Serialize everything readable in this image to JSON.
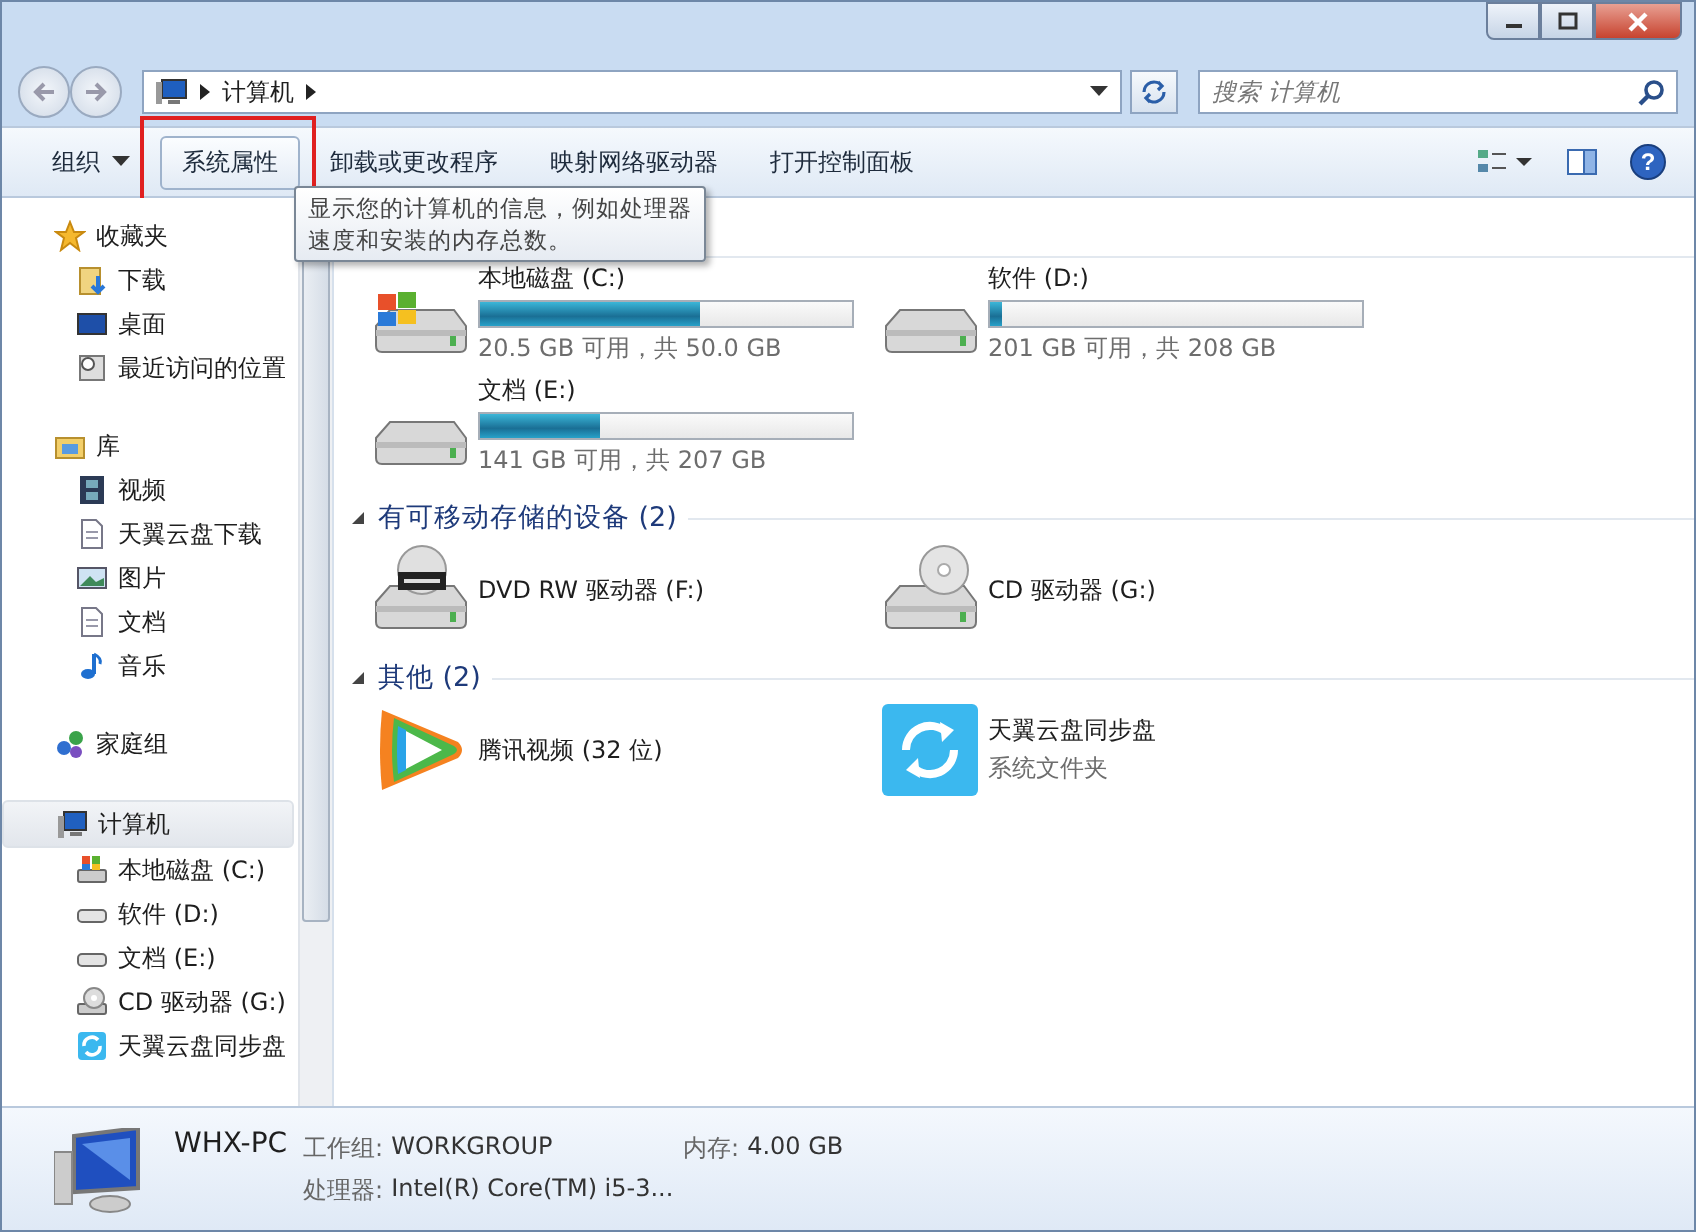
{
  "address_bar": {
    "path": [
      "计算机"
    ]
  },
  "search": {
    "placeholder": "搜索 计算机"
  },
  "toolbar": {
    "items": [
      {
        "label": "组织",
        "dropdown": true,
        "annotated": false
      },
      {
        "label": "系统属性",
        "dropdown": false,
        "annotated": true
      },
      {
        "label": "卸载或更改程序",
        "dropdown": false,
        "annotated": false
      },
      {
        "label": "映射网络驱动器",
        "dropdown": false,
        "annotated": false
      },
      {
        "label": "打开控制面板",
        "dropdown": false,
        "annotated": false
      }
    ],
    "help_label": "?"
  },
  "tooltip": {
    "lines": [
      "显示您的计算机的信息，例如处理器",
      "速度和安装的内存总数。"
    ]
  },
  "sidebar": {
    "groups": [
      {
        "label": "收藏夹",
        "kind": "favorites",
        "selected": false,
        "children": [
          {
            "label": "下载",
            "kind": "downloads",
            "selected": false
          },
          {
            "label": "桌面",
            "kind": "desktop",
            "selected": false
          },
          {
            "label": "最近访问的位置",
            "kind": "recent",
            "selected": false
          }
        ]
      },
      {
        "label": "库",
        "kind": "libraries",
        "selected": false,
        "children": [
          {
            "label": "视频",
            "kind": "videos",
            "selected": false
          },
          {
            "label": "天翼云盘下载",
            "kind": "document",
            "selected": false
          },
          {
            "label": "图片",
            "kind": "pictures",
            "selected": false
          },
          {
            "label": "文档",
            "kind": "document",
            "selected": false
          },
          {
            "label": "音乐",
            "kind": "music",
            "selected": false
          }
        ]
      },
      {
        "label": "家庭组",
        "kind": "homegroup",
        "selected": false
      },
      {
        "label": "计算机",
        "kind": "computer",
        "selected": true,
        "children": [
          {
            "label": "本地磁盘 (C:)",
            "kind": "system_drive",
            "selected": false
          },
          {
            "label": "软件 (D:)",
            "kind": "drive",
            "selected": false
          },
          {
            "label": "文档 (E:)",
            "kind": "drive",
            "selected": false
          },
          {
            "label": "CD 驱动器 (G:)",
            "kind": "cd_drive",
            "selected": false
          },
          {
            "label": "天翼云盘同步盘",
            "kind": "sync_folder",
            "selected": false
          }
        ]
      }
    ]
  },
  "sections": [
    {
      "items": [
        {
          "kind": "system_drive",
          "name": "本地磁盘 (C:)",
          "level": 0.59,
          "detail": "20.5 GB 可用，共 50.0 GB"
        },
        {
          "kind": "drive",
          "name": "软件 (D:)",
          "level": 0.03,
          "detail": "201 GB 可用，共 208 GB"
        },
        {
          "kind": "drive",
          "name": "文档 (E:)",
          "level": 0.32,
          "detail": "141 GB 可用，共 207 GB"
        }
      ]
    },
    {
      "title": "有可移动存储的设备 (2)",
      "items": [
        {
          "kind": "dvd_drive",
          "name": "DVD RW 驱动器 (F:)"
        },
        {
          "kind": "cd_drive",
          "name": "CD 驱动器 (G:)"
        }
      ]
    },
    {
      "title": "其他 (2)",
      "items": [
        {
          "kind": "app",
          "name": "腾讯视频 (32 位)"
        },
        {
          "kind": "sync_folder",
          "name": "天翼云盘同步盘",
          "detail": "系统文件夹"
        }
      ]
    }
  ],
  "status_bar": {
    "name": "WHX-PC",
    "fields": [
      {
        "label": "工作组:",
        "value": "WORKGROUP"
      },
      {
        "label": "内存:",
        "value": "4.00 GB"
      },
      {
        "label": "处理器:",
        "value": "Intel(R) Core(TM) i5-3..."
      }
    ]
  }
}
